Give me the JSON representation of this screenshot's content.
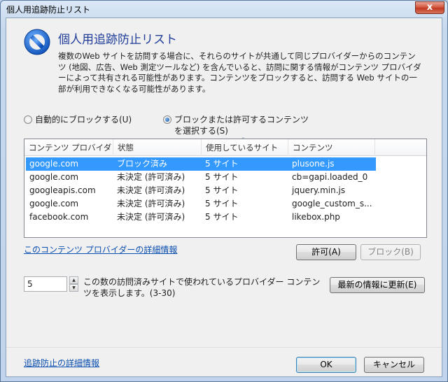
{
  "window": {
    "title": "個人用追跡防止リスト",
    "close_glyph": "x"
  },
  "header": {
    "icon": "prohibited-icon",
    "heading": "個人用追跡防止リスト",
    "description": "複数のWeb サイトを訪問する場合に、それらのサイトが共通して同じプロバイダーからのコンテンツ (地図、広告、Web 測定ツールなど) を含んでいると、訪問に関する情報がコンテンツ プロバイダーによって共有される可能性があります。コンテンツをブロックすると、訪問する Web サイトの一部が利用できなくなる可能性があります。"
  },
  "options": {
    "auto_block_label": "自動的にブロックする(U)",
    "choose_label_line1": "ブロックまたは許可するコンテンツ",
    "choose_label_line2": "を選択する(S)",
    "selected": "choose"
  },
  "table": {
    "columns": [
      "コンテンツ プロバイダー",
      "状態",
      "使用しているサイト",
      "コンテンツ"
    ],
    "sort_indicator": "^",
    "rows": [
      [
        "google.com",
        "ブロック済み",
        "5 サイト",
        "plusone.js"
      ],
      [
        "google.com",
        "未決定 (許可済み)",
        "5 サイト",
        "cb=gapi.loaded_0"
      ],
      [
        "googleapis.com",
        "未決定 (許可済み)",
        "5 サイト",
        "jquery.min.js"
      ],
      [
        "google.com",
        "未決定 (許可済み)",
        "5 サイト",
        "google_custom_s..."
      ],
      [
        "facebook.com",
        "未決定 (許可済み)",
        "5 サイト",
        "likebox.php"
      ]
    ],
    "selected_row": 0
  },
  "actions": {
    "provider_info_link": "このコンテンツ プロバイダーの詳細情報",
    "allow_button": "許可(A)",
    "block_button": "ブロック(B)"
  },
  "threshold": {
    "value": "5",
    "up_glyph": "▲",
    "down_glyph": "▼",
    "description": "この数の訪問済みサイトで使われているプロバイダー コンテンツを表示します。(3-30)",
    "refresh_button": "最新の情報に更新(E)"
  },
  "footer": {
    "help_link": "追跡防止の詳細情報",
    "ok_button": "OK",
    "cancel_button": "キャンセル"
  },
  "colors": {
    "heading": "#1f3d99",
    "selection": "#3399ff",
    "link": "#0b4fb0"
  }
}
